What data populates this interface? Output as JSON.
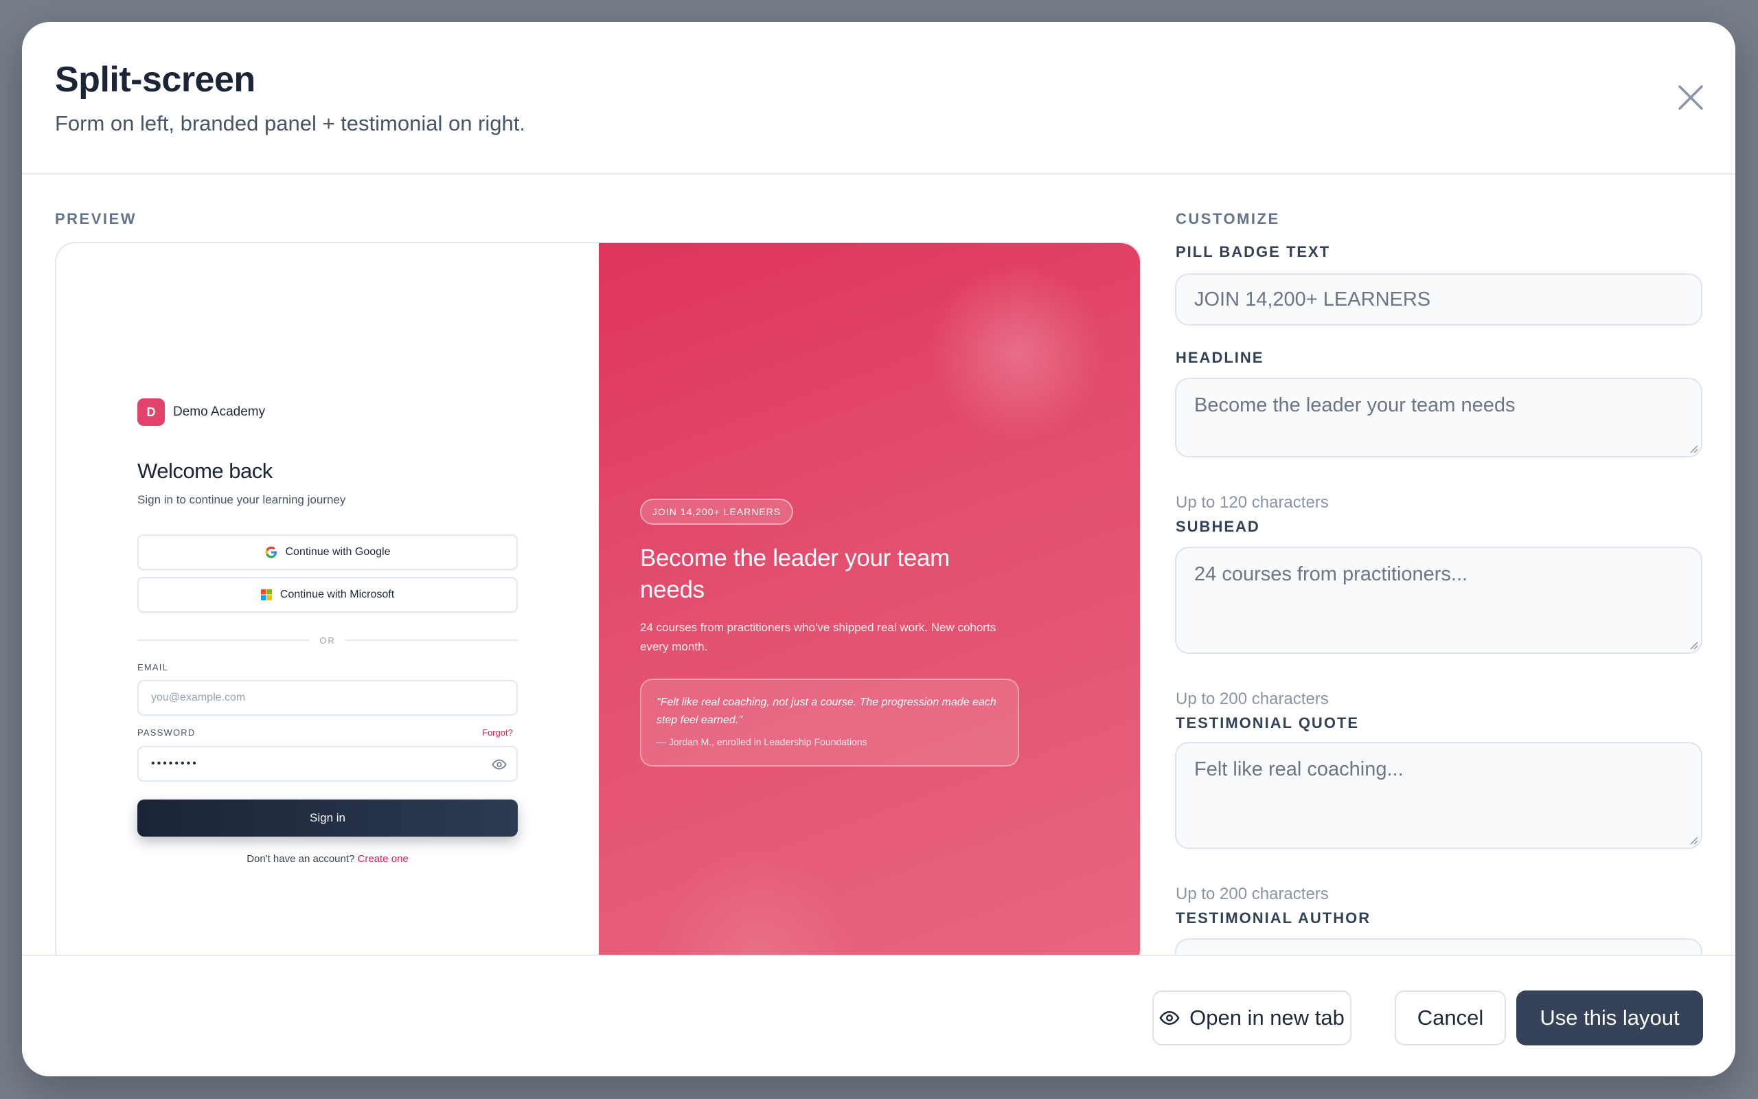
{
  "modal": {
    "title": "Split-screen",
    "subtitle": "Form on left, branded panel + testimonial on right."
  },
  "sections": {
    "preview": "PREVIEW",
    "customize": "CUSTOMIZE"
  },
  "preview": {
    "brand_initial": "D",
    "brand_name": "Demo Academy",
    "welcome": "Welcome back",
    "welcome_sub": "Sign in to continue your learning journey",
    "google_button": "Continue with Google",
    "microsoft_button": "Continue with Microsoft",
    "or_divider": "OR",
    "email_label": "EMAIL",
    "email_placeholder": "you@example.com",
    "password_label": "PASSWORD",
    "forgot_link": "Forgot?",
    "password_value": "••••••••",
    "signin_button": "Sign in",
    "signup_prompt": "Don't have an account?",
    "signup_link": "Create one",
    "pill_badge": "JOIN 14,200+ LEARNERS",
    "headline": "Become the leader your team needs",
    "subhead": "24 courses from practitioners who've shipped real work. New cohorts every month.",
    "testimonial_quote": "\"Felt like real coaching, not just a course. The progression made each step feel earned.\"",
    "testimonial_author": "— Jordan M., enrolled in Leadership Foundations",
    "brand_color": "#e2436a"
  },
  "customize": {
    "pill_label": "PILL BADGE TEXT",
    "pill_placeholder": "JOIN 14,200+ LEARNERS",
    "headline_label": "HEADLINE",
    "headline_placeholder": "Become the leader your team needs",
    "headline_hint": "Up to 120 characters",
    "subhead_label": "SUBHEAD",
    "subhead_placeholder": "24 courses from practitioners...",
    "subhead_hint": "Up to 200 characters",
    "quote_label": "TESTIMONIAL QUOTE",
    "quote_placeholder": "Felt like real coaching...",
    "quote_hint": "Up to 200 characters",
    "author_label": "TESTIMONIAL AUTHOR"
  },
  "footer": {
    "open_new_tab": "Open in new tab",
    "cancel": "Cancel",
    "use_layout": "Use this layout"
  },
  "icons": {
    "close": "close-icon",
    "eye": "eye-icon",
    "google": "google-icon",
    "microsoft": "microsoft-icon"
  }
}
